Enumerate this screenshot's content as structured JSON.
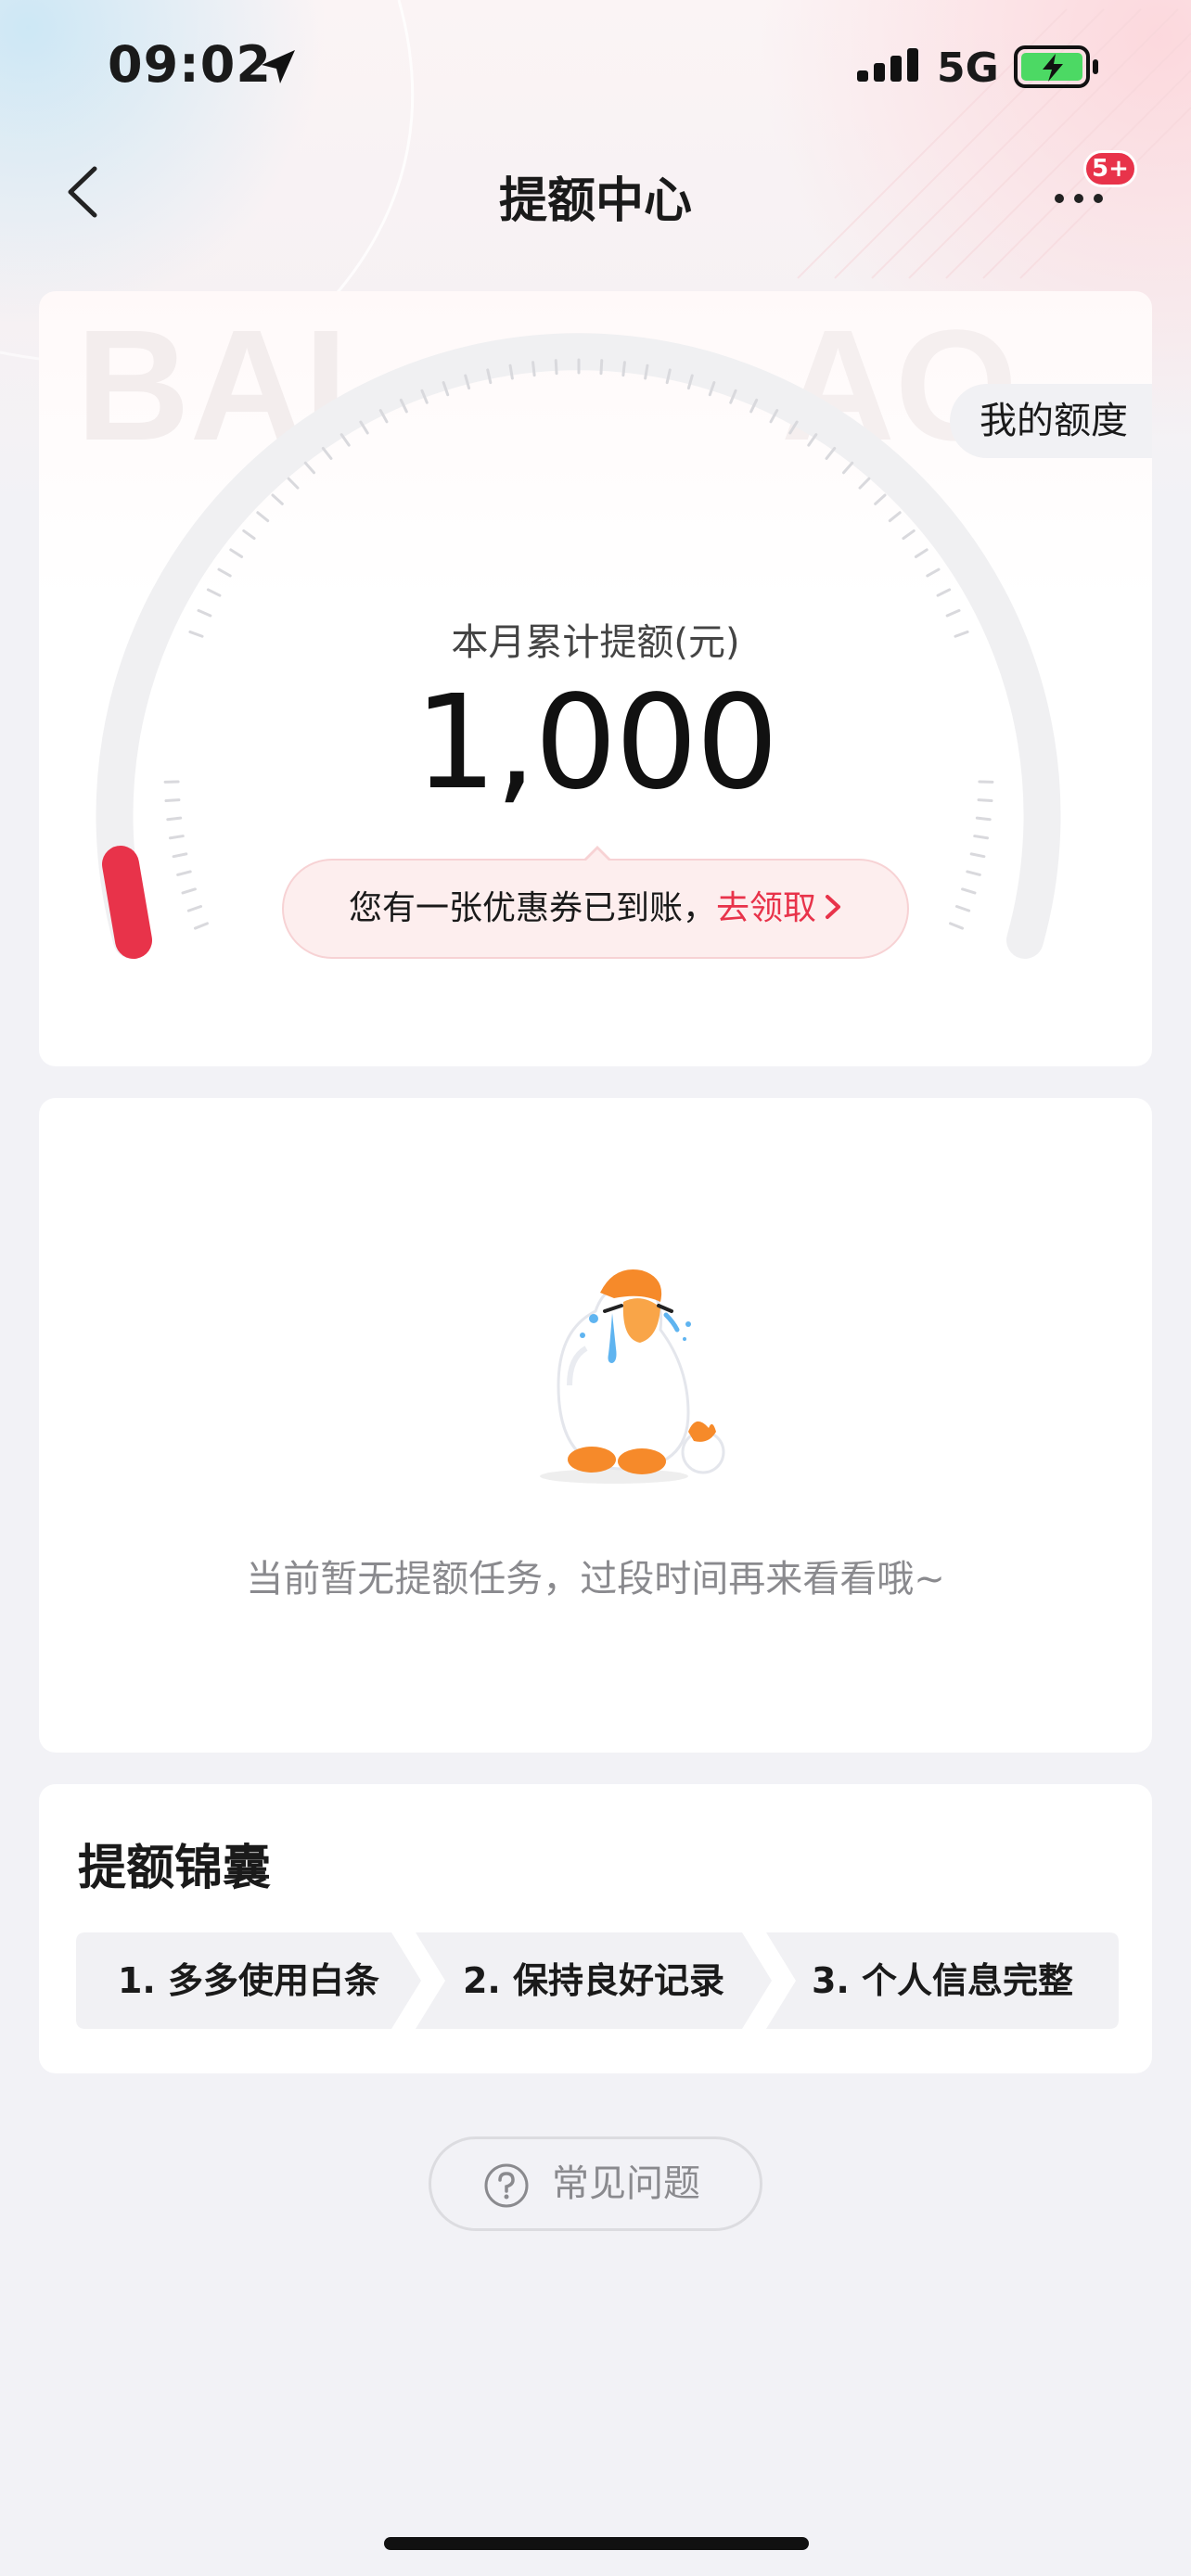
{
  "status_bar": {
    "time": "09:02",
    "network": "5G"
  },
  "nav": {
    "title": "提额中心",
    "more_badge": "5+"
  },
  "limit_card": {
    "my_limit_label": "我的额度",
    "label": "本月累计提额(元)",
    "value": "1,000",
    "coupon_text": "您有一张优惠券已到账，",
    "coupon_link": "去领取"
  },
  "empty_state": {
    "text": "当前暂无提额任务，过段时间再来看看哦~"
  },
  "tips": {
    "title": "提额锦囊",
    "steps": [
      "1. 多多使用白条",
      "2. 保持良好记录",
      "3. 个人信息完整"
    ]
  },
  "faq": {
    "label": "常见问题"
  },
  "colors": {
    "accent": "#e8334a",
    "background": "#f2f2f6"
  }
}
